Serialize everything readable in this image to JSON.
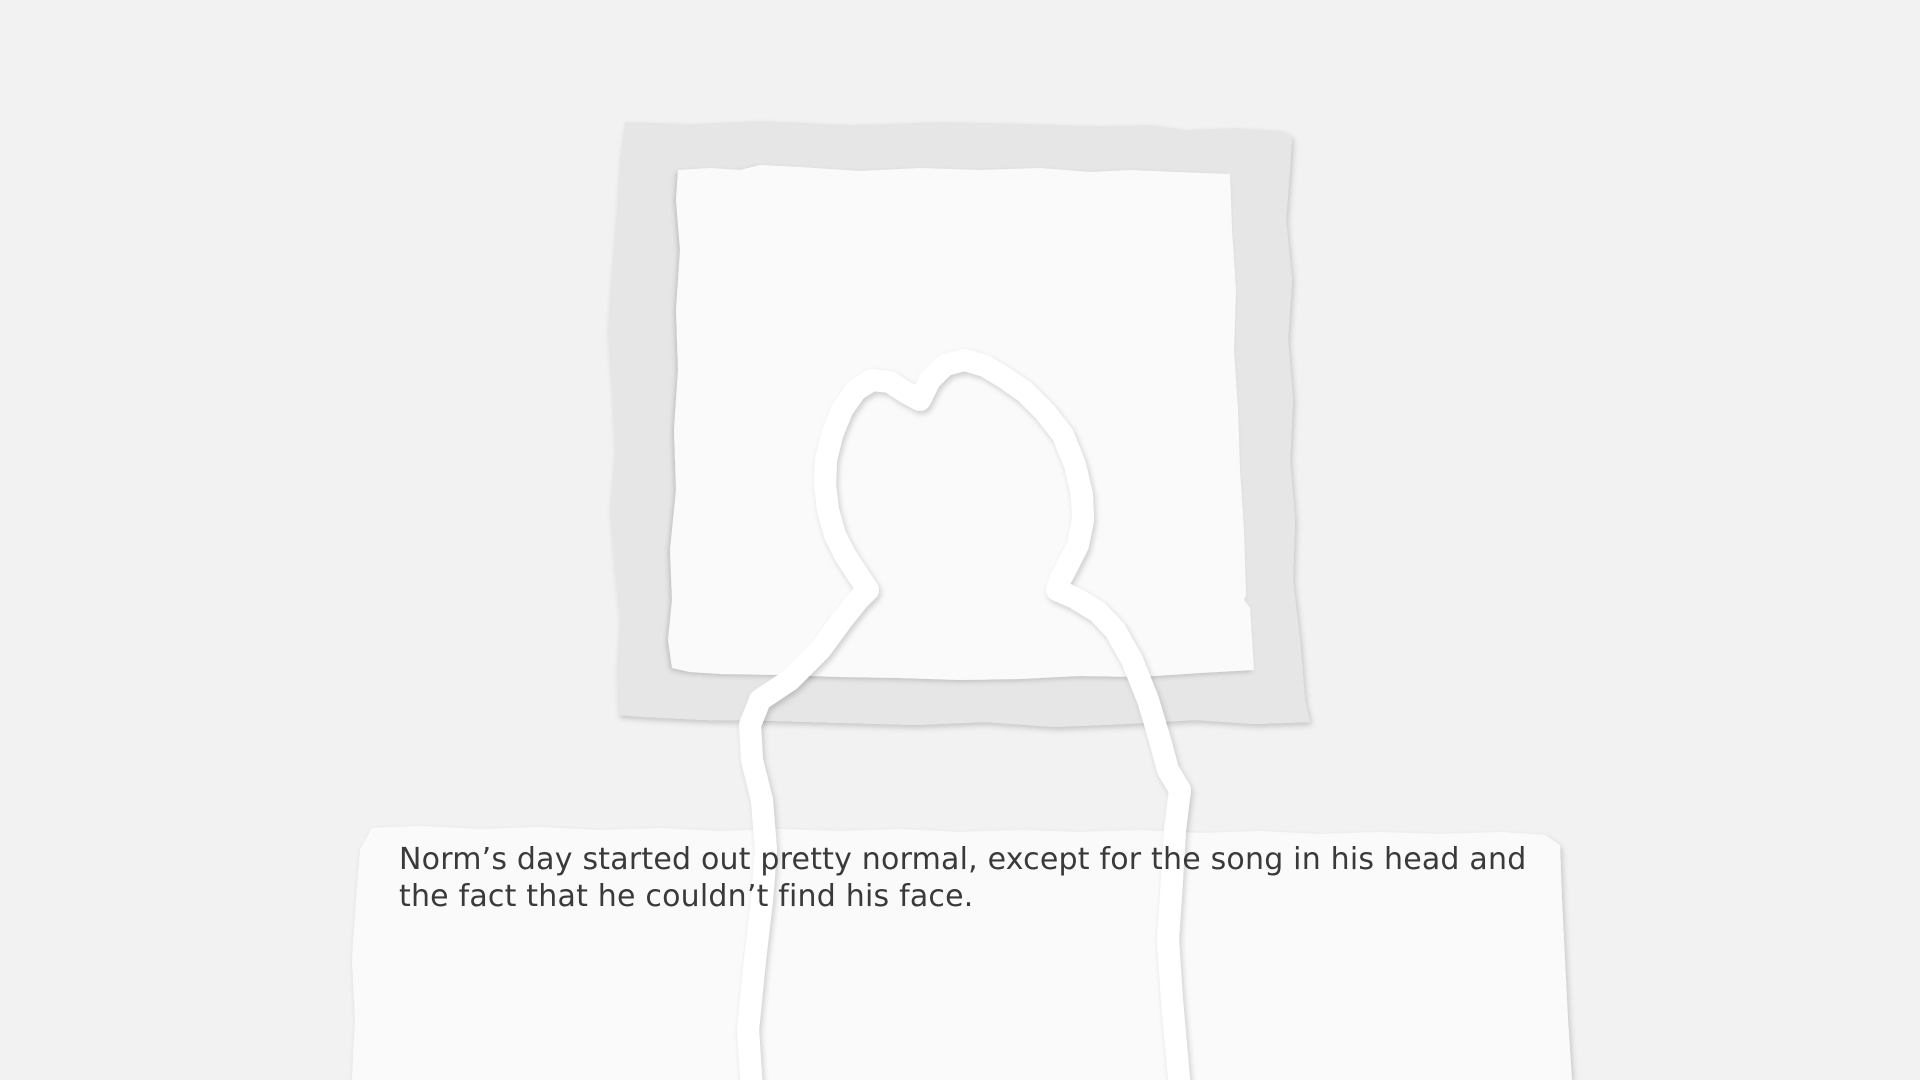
{
  "scene": {
    "background_color": "#f2f2f2",
    "frame_color": "#e6e6e6",
    "paper_color": "#fafafa",
    "silhouette_outline_color": "#ffffff",
    "text_color": "#3a3a3a"
  },
  "dialogue": {
    "text": "Norm’s day started out pretty normal, except for the song in his head and the fact that he couldn’t find his face."
  }
}
